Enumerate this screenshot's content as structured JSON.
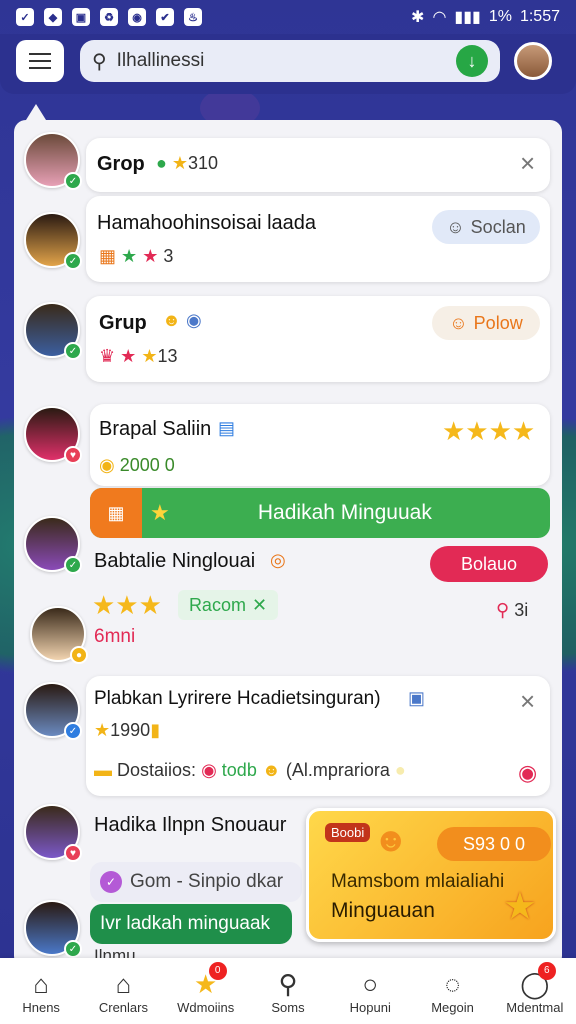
{
  "status_bar": {
    "time": "1:557",
    "battery": "1%"
  },
  "search": {
    "query": "Ilhallinessi"
  },
  "items": [
    {
      "name": "Grop",
      "sub": "310"
    },
    {
      "name": "Hamahoohinsoisai laada",
      "sub": "3",
      "action": "Soclan"
    },
    {
      "name": "Grup",
      "sub": "13",
      "action": "Polow"
    },
    {
      "name": "Brapal Saliin",
      "sub": "2000 0"
    },
    {
      "name": "Babtalie Ninglouai",
      "action": "Bolauo",
      "chip": "Racom",
      "aside": "3i",
      "foot": "6mni"
    },
    {
      "name": "Plabkan Lyrirere Hcadietsinguran)",
      "sub": "1990",
      "detail": "Dostaiios:",
      "detail_accent": "todb",
      "detail_tail": "(Al.mprariora"
    },
    {
      "name": "Hadika Ilnpn Snouaur",
      "gom": "Gom - Sinpio dkar",
      "btn": "Ivr ladkah minguaak",
      "tail": "Ilnmu"
    }
  ],
  "green_banner": "Hadikah Minguuak",
  "promo": {
    "tag": "Boobi",
    "price": "S93 0 0",
    "line1": "Mamsbom mlaialiahi",
    "line2": "Minguauan"
  },
  "bottom_nav": [
    {
      "label": "Hnens",
      "icon": "home-icon"
    },
    {
      "label": "Crenlars",
      "icon": "store-icon"
    },
    {
      "label": "Wdmoiins",
      "icon": "star-icon",
      "count": "0"
    },
    {
      "label": "Soms",
      "icon": "search-icon"
    },
    {
      "label": "Hopuni",
      "icon": "chat-icon"
    },
    {
      "label": "Megoin",
      "icon": "message-icon"
    },
    {
      "label": "Mdentmal",
      "icon": "notification-icon",
      "count": "6"
    }
  ],
  "colors": {
    "primary": "#2c318f",
    "green": "#3cae50",
    "red": "#e22a55",
    "orange": "#f28e1d"
  }
}
